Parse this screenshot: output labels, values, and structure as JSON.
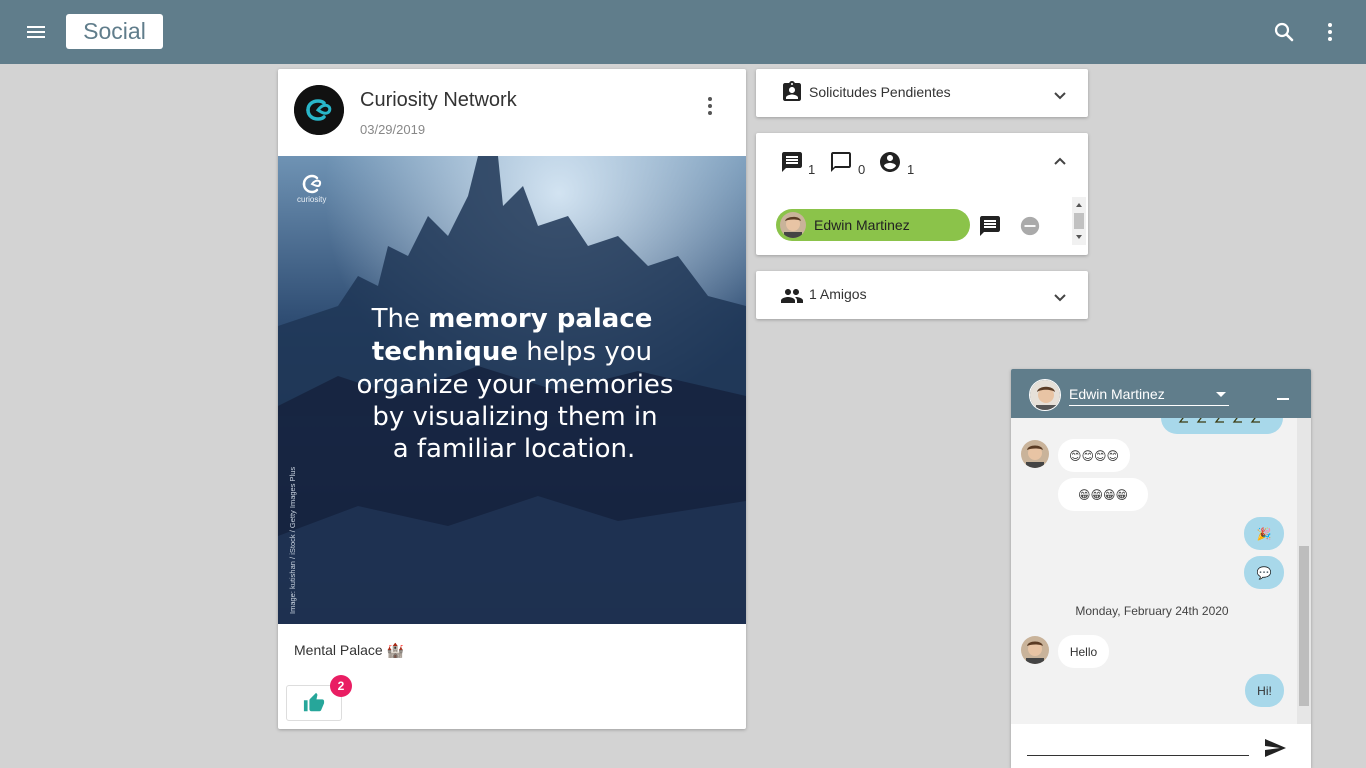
{
  "app": {
    "title": "Social"
  },
  "header": {
    "menu_icon": "menu-icon",
    "search_icon": "search-icon",
    "more_icon": "more-vert-icon"
  },
  "post": {
    "author": "Curiosity Network",
    "date": "03/29/2019",
    "image": {
      "brand": "curiosity",
      "line1_bold": "The ",
      "line1_strong": "memory palace",
      "line2_strong": "technique",
      "line2_rest": " helps you",
      "line3": "organize your memories",
      "line4": "by visualizing them in",
      "line5": "a familiar location.",
      "credit": "Image: kutishan / iStock / Getty Images Plus"
    },
    "caption": "Mental Palace 🏰",
    "likes": "2"
  },
  "panels": {
    "pending": {
      "label": "Solicitudes Pendientes"
    },
    "counts": {
      "messages": "1",
      "comments": "0",
      "users": "1"
    },
    "friend": {
      "name": "Edwin Martinez"
    },
    "friends": {
      "label": "1 Amigos"
    }
  },
  "chat": {
    "contact": "Edwin Martinez",
    "messages": [
      {
        "from": "them",
        "text": "😊😊😊😊"
      },
      {
        "from": "them",
        "text": "😁😁😁😁"
      },
      {
        "from": "me",
        "text": "🎉"
      },
      {
        "from": "me",
        "text": "💬"
      },
      {
        "from": "them",
        "text": "Hello"
      },
      {
        "from": "me",
        "text": "Hi!"
      }
    ],
    "day_separator": "Monday, February 24th 2020",
    "input_value": ""
  },
  "colors": {
    "appbar": "#607d8b",
    "chip": "#8bc34a",
    "badge": "#e91e63",
    "my_bubble": "#a8d8ea"
  }
}
